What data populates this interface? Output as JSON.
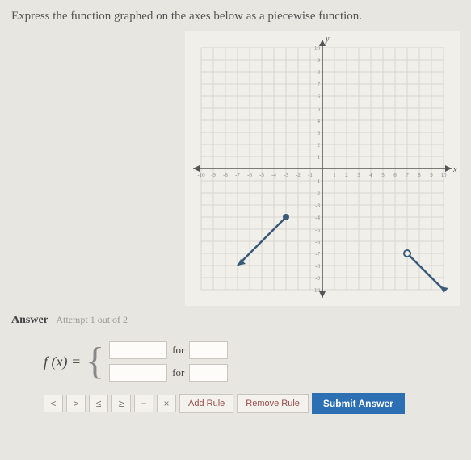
{
  "prompt": "Express the function graphed on the axes below as a piecewise function.",
  "answer_label": "Answer",
  "attempts_text": "Attempt 1 out of 2",
  "fx_label": "f (x) =",
  "for_label": "for",
  "symbol_buttons": [
    "<",
    ">",
    "≤",
    "≥",
    "−",
    "×"
  ],
  "add_rule_label": "Add Rule",
  "remove_rule_label": "Remove Rule",
  "submit_label": "Submit Answer",
  "axes": {
    "x_label": "x",
    "y_label": "y"
  },
  "chart_data": {
    "type": "line",
    "title": "",
    "xlabel": "x",
    "ylabel": "y",
    "xlim": [
      -10,
      10
    ],
    "ylim": [
      -10,
      10
    ],
    "series": [
      {
        "name": "segment-1",
        "x": [
          -7,
          -3
        ],
        "y": [
          -8,
          -4
        ],
        "endpoints": {
          "start": "arrow",
          "end": "closed"
        }
      },
      {
        "name": "segment-2",
        "x": [
          7,
          10
        ],
        "y": [
          -7,
          -10
        ],
        "endpoints": {
          "start": "open",
          "end": "arrow"
        }
      }
    ]
  }
}
